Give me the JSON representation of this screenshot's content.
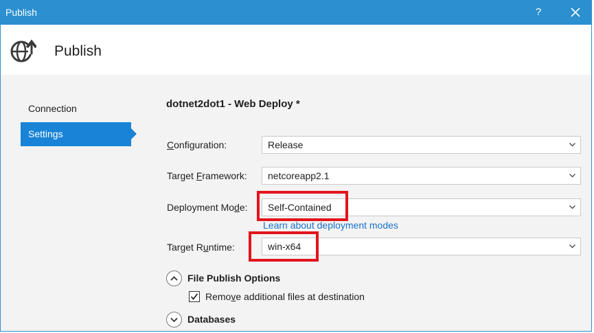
{
  "window": {
    "title": "Publish",
    "help_label": "?",
    "close_icon": "close-icon"
  },
  "header": {
    "icon": "globe-upload-icon",
    "title": "Publish"
  },
  "sidebar": {
    "items": [
      {
        "label": "Connection",
        "selected": false
      },
      {
        "label": "Settings",
        "selected": true
      }
    ],
    "selected_color": "#1883d7"
  },
  "main": {
    "profile_title": "dotnet2dot1 - Web Deploy *",
    "fields": {
      "configuration": {
        "label_pre": "",
        "label_key": "C",
        "label_post": "onfiguration:",
        "value": "Release"
      },
      "target_framework": {
        "label_pre": "Target ",
        "label_key": "F",
        "label_post": "ramework:",
        "value": "netcoreapp2.1"
      },
      "deployment_mode": {
        "label_pre": "Deployment Mo",
        "label_key": "d",
        "label_post": "e:",
        "value": "Self-Contained"
      },
      "target_runtime": {
        "label_pre": "Target R",
        "label_key": "u",
        "label_post": "ntime:",
        "value": "win-x64"
      }
    },
    "deployment_link": "Learn about deployment modes",
    "file_publish_options": {
      "title": "File Publish Options",
      "expanded": true,
      "checkbox": {
        "label_pre": "Remo",
        "label_key": "v",
        "label_post": "e additional files at destination",
        "checked": true
      }
    },
    "databases": {
      "title": "Databases",
      "expanded": false
    }
  },
  "colors": {
    "titlebar": "#2b8fd0",
    "highlight_box": "#e2141c",
    "link": "#1a73c9"
  }
}
